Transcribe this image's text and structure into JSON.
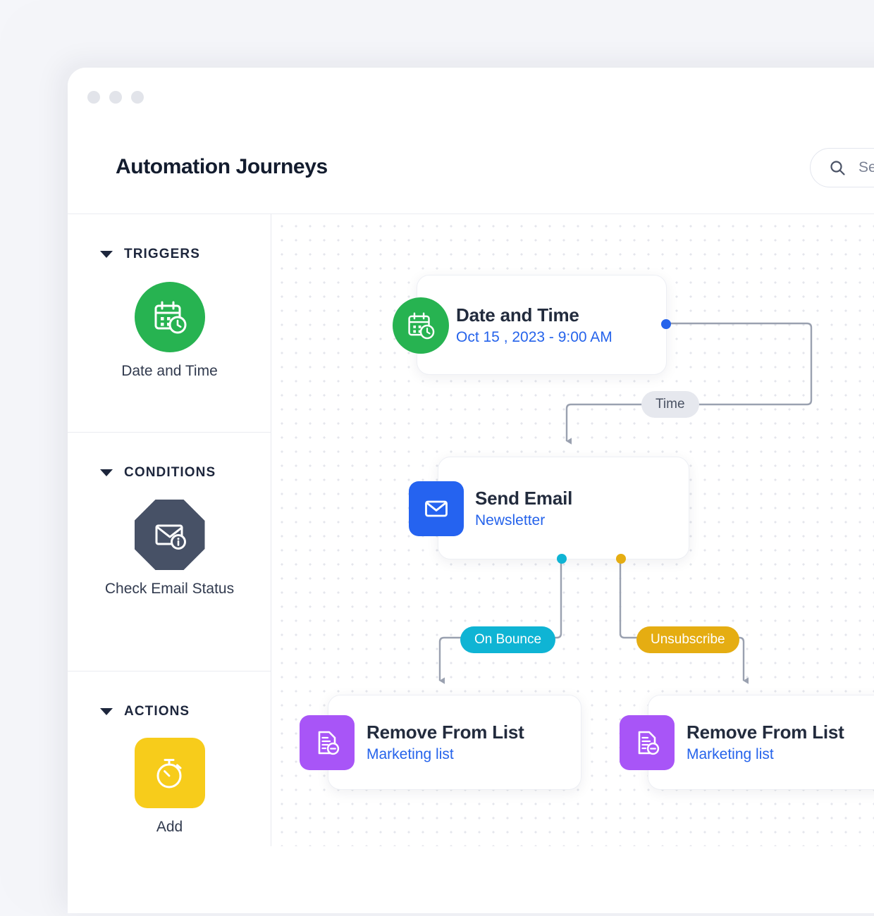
{
  "window": {
    "dots": [
      "window-dot-1",
      "window-dot-2",
      "window-dot-3"
    ]
  },
  "header": {
    "title": "Automation Journeys",
    "search": {
      "icon": "search-icon",
      "placeholder": "Se",
      "value": "Se"
    }
  },
  "sidebar": {
    "sections": [
      {
        "title": "TRIGGERS",
        "caret": "chevron-down-icon",
        "items": [
          {
            "label": "Date and Time",
            "icon": "calendar-clock-icon",
            "shape": "circle",
            "color": "#27b351"
          }
        ]
      },
      {
        "title": "CONDITIONS",
        "caret": "chevron-down-icon",
        "items": [
          {
            "label": "Check Email Status",
            "icon": "envelope-info-icon",
            "shape": "octagon",
            "color": "#475166"
          }
        ]
      },
      {
        "title": "ACTIONS",
        "caret": "chevron-down-icon",
        "items": [
          {
            "label": "Add",
            "icon": "stopwatch-icon",
            "shape": "square",
            "color": "#f7cc1b"
          }
        ]
      }
    ]
  },
  "canvas": {
    "nodes": [
      {
        "id": "date-and-time",
        "title": "Date and Time",
        "subtitle": "Oct 15 , 2023 - 9:00 AM",
        "icon": "calendar-clock-icon",
        "icon_shape": "circle",
        "icon_color": "#27b351",
        "ports": [
          {
            "name": "output-port-time",
            "color": "#2563eb"
          }
        ]
      },
      {
        "id": "send-email",
        "title": "Send Email",
        "subtitle": "Newsletter",
        "icon": "envelope-icon",
        "icon_shape": "square",
        "icon_color": "#2563f0",
        "ports": [
          {
            "name": "output-port-on-bounce",
            "color": "#0fb4d4"
          },
          {
            "name": "output-port-unsubscribe",
            "color": "#e5ad12"
          }
        ]
      },
      {
        "id": "remove-from-list-1",
        "title": "Remove From List",
        "subtitle": "Marketing list",
        "icon": "document-minus-icon",
        "icon_shape": "square",
        "icon_color": "#a855f7",
        "ports": []
      },
      {
        "id": "remove-from-list-2",
        "title": "Remove From List",
        "subtitle": "Marketing list",
        "icon": "document-minus-icon",
        "icon_shape": "square",
        "icon_color": "#a855f7",
        "ports": []
      }
    ],
    "edge_labels": [
      {
        "id": "time",
        "text": "Time",
        "style": "gray",
        "color": "#e6e8ee"
      },
      {
        "id": "on-bounce",
        "text": "On Bounce",
        "style": "cyan",
        "color": "#0fb4d4"
      },
      {
        "id": "unsubscribe",
        "text": "Unsubscribe",
        "style": "amber",
        "color": "#e5ad12"
      }
    ],
    "wire_color": "#9aa1b0",
    "grid": "dotted"
  },
  "theme": {
    "page_background": "#f5f6fa",
    "surface": "#ffffff",
    "accent_blue": "#2563eb",
    "text_primary": "#131c2e",
    "text_muted": "#7b8294"
  }
}
